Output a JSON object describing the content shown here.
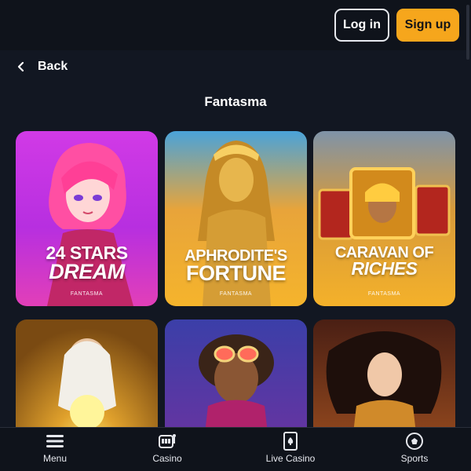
{
  "header": {
    "login_label": "Log in",
    "signup_label": "Sign up",
    "accent_color": "#f6a61c"
  },
  "back": {
    "label": "Back",
    "icon": "chevron-left-icon"
  },
  "page": {
    "title": "Fantasma"
  },
  "games": [
    {
      "title_line1": "24 STARS",
      "title_line2": "DREAM",
      "provider": "FANTASMA"
    },
    {
      "title_line1": "APHRODITE'S",
      "title_line2": "FORTUNE",
      "provider": "FANTASMA"
    },
    {
      "title_line1": "CARAVAN OF",
      "title_line2": "RICHES",
      "provider": "FANTASMA"
    },
    {
      "title_line1": "",
      "title_line2": "",
      "provider": ""
    },
    {
      "title_line1": "",
      "title_line2": "",
      "provider": ""
    },
    {
      "title_line1": "",
      "title_line2": "",
      "provider": ""
    }
  ],
  "bottom_nav": [
    {
      "label": "Menu",
      "icon": "hamburger-menu-icon"
    },
    {
      "label": "Casino",
      "icon": "slot-machine-icon"
    },
    {
      "label": "Live Casino",
      "icon": "playing-card-icon"
    },
    {
      "label": "Sports",
      "icon": "soccer-ball-icon"
    }
  ]
}
